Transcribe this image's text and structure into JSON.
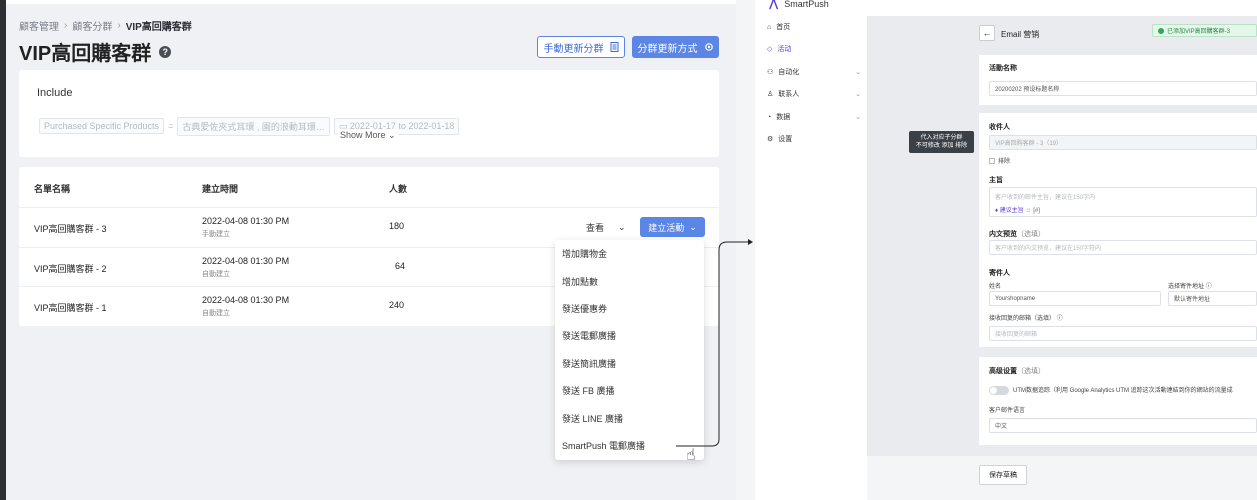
{
  "breadcrumb": {
    "items": [
      "顧客管理",
      "顧客分群"
    ],
    "current": "VIP高回購客群"
  },
  "page": {
    "title": "VIP高回購客群",
    "help_icon": "?"
  },
  "toolbar": {
    "manual_update_label": "手動更新分群",
    "update_method_label": "分群更新方式"
  },
  "include": {
    "title": "Include",
    "filter_field": "Purchased Specific Products",
    "filter_operator": "=",
    "filter_value": "古典愛佐夾式耳環 , 園的浪動耳環…",
    "filter_date": "2022-01-17 to 2022-01-18",
    "show_more": "Show More"
  },
  "table": {
    "headers": {
      "name": "名單名稱",
      "time": "建立時間",
      "count": "人數"
    },
    "rows": [
      {
        "name": "VIP高回購客群 - 3",
        "time": "2022-04-08 01:30 PM",
        "method": "手動建立",
        "count": "180"
      },
      {
        "name": "VIP高回購客群 - 2",
        "time": "2022-04-08 01:30 PM",
        "method": "自動建立",
        "count": "64"
      },
      {
        "name": "VIP高回購客群 - 1",
        "time": "2022-04-08 01:30 PM",
        "method": "自動建立",
        "count": "240"
      }
    ],
    "view_label": "查看",
    "create_label": "建立活動"
  },
  "dropdown": {
    "items": [
      "增加購物金",
      "增加點數",
      "發送優惠券",
      "發送電郵廣播",
      "發送簡訊廣播",
      "發送 FB 廣播",
      "發送 LINE 廣播",
      "SmartPush 電郵廣播"
    ]
  },
  "smartpush": {
    "brand": "SmartPush",
    "sidebar": [
      {
        "label": "首页",
        "icon": "home-icon",
        "chevron": false
      },
      {
        "label": "活动",
        "icon": "tag-icon",
        "chevron": false,
        "active": true
      },
      {
        "label": "自动化",
        "icon": "automation-icon",
        "chevron": true
      },
      {
        "label": "联系人",
        "icon": "person-icon",
        "chevron": true
      },
      {
        "label": "数据",
        "icon": "chart-icon",
        "chevron": true
      },
      {
        "label": "设置",
        "icon": "gear-icon",
        "chevron": false
      }
    ],
    "header": {
      "title": "Email 营销",
      "badge": "已添加VIP高回購客群-3"
    },
    "tooltip": {
      "line1": "代入对应子分群",
      "line2": "不可修改 添加 排除"
    },
    "form": {
      "campaign_name_label": "活動名称",
      "campaign_name_value": "20200202 预设标题名称",
      "recipient_label": "收件人",
      "recipient_value": "VIP高回购客群 - 3（19）",
      "exclude_label": "排除",
      "subject_label": "主旨",
      "subject_placeholder": "客户收到的邮件主旨，建议在150字内",
      "subject_suggest": "建议主旨",
      "subject_count": "[#]",
      "preview_label": "内文预览",
      "preview_optional": "（选填）",
      "preview_placeholder": "客户收到的内文预览，建议在150字符内",
      "sender_label": "寄件人",
      "sender_name_label": "姓名",
      "sender_name_value": "Yourshopname",
      "sender_address_label": "选择寄件地址",
      "sender_address_value": "默认寄件地址",
      "reply_label": "接收回复的邮箱（选填）",
      "reply_placeholder": "接收回复的邮箱",
      "advanced_label": "高级设置",
      "advanced_optional": "（选填）",
      "utm_text": "UTM数据追踪（利用 Google Analytics UTM 追踪这次活動連結到你的網站的流量成",
      "language_label": "客户邮件语言",
      "language_value": "中文",
      "save_label": "保存草稿"
    }
  },
  "colors": {
    "primary": "#5b86e5",
    "smartpush_accent": "#5b3bd6",
    "success": "#2fa85a"
  }
}
